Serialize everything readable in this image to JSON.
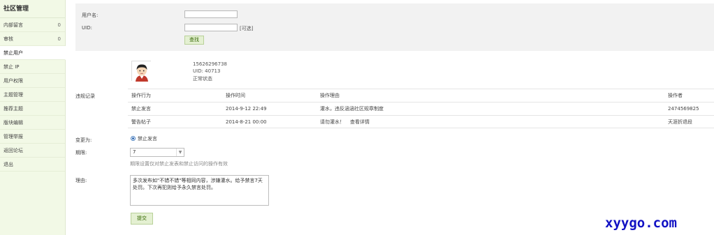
{
  "sidebar": {
    "title": "社区管理",
    "items": [
      {
        "label": "内部留言",
        "count": "0"
      },
      {
        "label": "审核",
        "count": "0"
      },
      {
        "label": "禁止用户",
        "count": ""
      },
      {
        "label": "禁止 IP",
        "count": ""
      },
      {
        "label": "用户权限",
        "count": ""
      },
      {
        "label": "主题管理",
        "count": ""
      },
      {
        "label": "推荐主题",
        "count": ""
      },
      {
        "label": "版块编辑",
        "count": ""
      },
      {
        "label": "管理举报",
        "count": ""
      },
      {
        "label": "返回论坛",
        "count": ""
      },
      {
        "label": "退出",
        "count": ""
      }
    ],
    "active_index": 2
  },
  "search": {
    "username_label": "用户名:",
    "username_value": "",
    "uid_label": "UID:",
    "uid_value": "",
    "uid_hint": "[可选]",
    "search_button": "查找"
  },
  "user": {
    "avatar_icon": "user-avatar-icon",
    "username": "15626296738",
    "uid": "UID: 40713",
    "status": "正常状态"
  },
  "records": {
    "label": "违规记录",
    "headers": [
      "操作行为",
      "操作时间",
      "操作理由",
      "操作者"
    ],
    "rows": [
      {
        "action": "禁止发言",
        "time": "2014-9-12 22:49",
        "reason": "灌水，违反涵涵社区规章制度",
        "reason_link": "",
        "operator": "2474569825"
      },
      {
        "action": "警告帖子",
        "time": "2014-8-21 00:00",
        "reason": "请勿灌水！",
        "reason_link": "查看详情",
        "operator": "天涯折退段"
      }
    ]
  },
  "form": {
    "change_label": "变更为:",
    "radio_label": "禁止发言",
    "period_label": "期限:",
    "period_value": "7",
    "period_note": "期限设置仅对禁止发表和禁止访问的操作有效",
    "reason_label": "理由:",
    "reason_text": "多次发布如\"不错不错\"等相同内容，涉嫌灌水。给予禁言7天处罚。下次再犯则给予永久禁言处罚。",
    "submit_button": "提交"
  },
  "watermark": "xyygo.com"
}
